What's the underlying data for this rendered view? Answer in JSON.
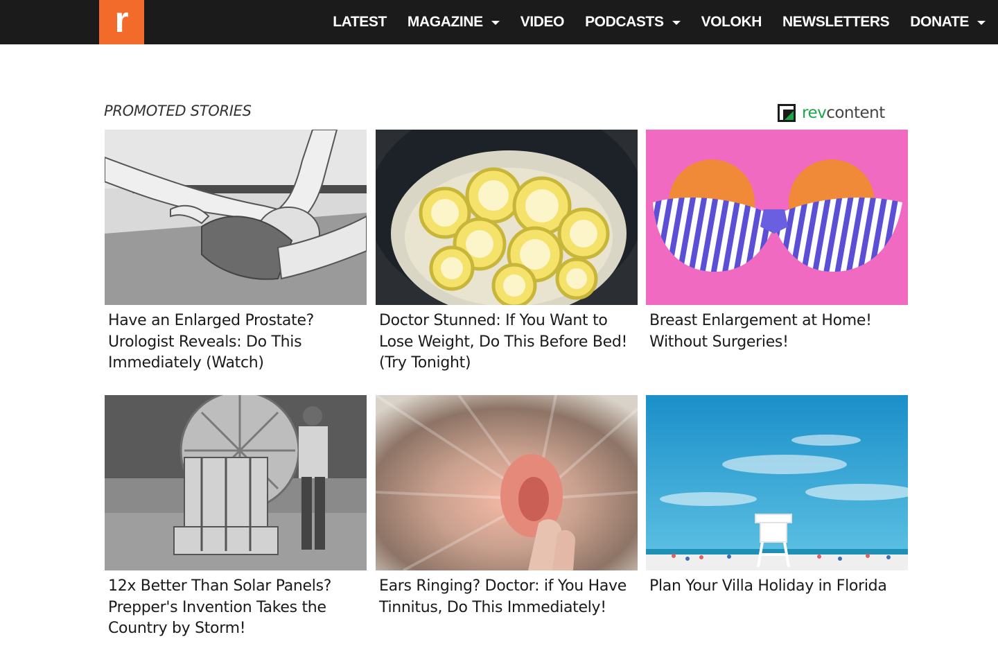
{
  "header": {
    "logo_letter": "r",
    "nav": [
      {
        "label": "LATEST",
        "dropdown": false
      },
      {
        "label": "MAGAZINE",
        "dropdown": true
      },
      {
        "label": "VIDEO",
        "dropdown": false
      },
      {
        "label": "PODCASTS",
        "dropdown": true
      },
      {
        "label": "VOLOKH",
        "dropdown": false
      },
      {
        "label": "NEWSLETTERS",
        "dropdown": false
      },
      {
        "label": "DONATE",
        "dropdown": true
      }
    ]
  },
  "promoted": {
    "label": "PROMOTED STORIES",
    "provider_brand_a": "rev",
    "provider_brand_b": "content",
    "stories": [
      {
        "title": "Have an Enlarged Prostate? Urologist Reveals: Do This Immediately (Watch)",
        "image": "grayscale-illustration-man-stretching-leg"
      },
      {
        "title": "Doctor Stunned: If You Want to Lose Weight, Do This Before Bed! (Try Tonight)",
        "image": "lemon-slices-boiling-in-pot"
      },
      {
        "title": "Breast Enlargement at Home! Without Surgeries!",
        "image": "grapefruits-in-striped-bra-on-pink"
      },
      {
        "title": "12x Better Than Solar Panels? Prepper's Invention Takes the Country by Storm!",
        "image": "man-beside-wooden-wind-turbine"
      },
      {
        "title": "Ears Ringing? Doctor: if You Have Tinnitus, Do This Immediately!",
        "image": "hand-touching-ear-blurred"
      },
      {
        "title": "Plan Your Villa Holiday in Florida",
        "image": "beach-lifeguard-tower-blue-sky"
      }
    ]
  },
  "colors": {
    "logo_bg": "#f26b2a",
    "topbar_bg": "#1b1b1b",
    "rev_green": "#1aa74a"
  }
}
